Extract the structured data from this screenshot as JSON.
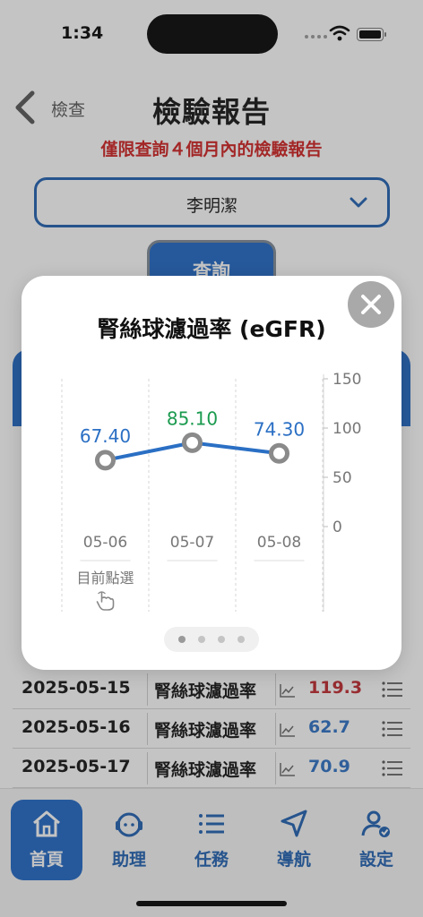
{
  "status": {
    "time": "1:34"
  },
  "header": {
    "back_label": "檢查",
    "title": "檢驗報告",
    "notice": "僅限查詢４個月內的檢驗報告"
  },
  "patient_select": {
    "value": "李明潔"
  },
  "query_button": {
    "label": "查詢"
  },
  "modal": {
    "title": "腎絲球濾過率 (eGFR)",
    "selected_label": "目前點選",
    "page_count": 4,
    "active_page": 0
  },
  "chart_data": {
    "type": "line",
    "x": [
      "05-06",
      "05-07",
      "05-08"
    ],
    "series": [
      {
        "values": [
          67.4,
          85.1,
          74.3
        ],
        "labels": [
          "67.40",
          "85.10",
          "74.30"
        ],
        "label_colors": [
          "#2a6fc4",
          "#1b9a4f",
          "#2a6fc4"
        ]
      }
    ],
    "y_ticks": [
      "150",
      "100",
      "50",
      "0"
    ],
    "ylim": [
      0,
      150
    ],
    "selected_index": 0,
    "grid": true,
    "colors": {
      "line": "#2a6fc4",
      "point_stroke": "#8a8a8a"
    }
  },
  "reports": [
    {
      "date": "2025-05-15",
      "item": "腎絲球濾過率",
      "value": "119.3",
      "color": "#c0282d"
    },
    {
      "date": "2025-05-16",
      "item": "腎絲球濾過率",
      "value": "62.7",
      "color": "#2a6fc4"
    },
    {
      "date": "2025-05-17",
      "item": "腎絲球濾過率",
      "value": "70.9",
      "color": "#2a6fc4"
    }
  ],
  "tabbar": {
    "items": [
      {
        "label": "首頁",
        "icon": "home-icon"
      },
      {
        "label": "助理",
        "icon": "assistant-icon"
      },
      {
        "label": "任務",
        "icon": "list-icon"
      },
      {
        "label": "導航",
        "icon": "navigation-icon"
      },
      {
        "label": "設定",
        "icon": "settings-user-icon"
      }
    ],
    "active": 0
  },
  "colors": {
    "brand": "#1e66c4",
    "alert": "#d01f1f"
  }
}
